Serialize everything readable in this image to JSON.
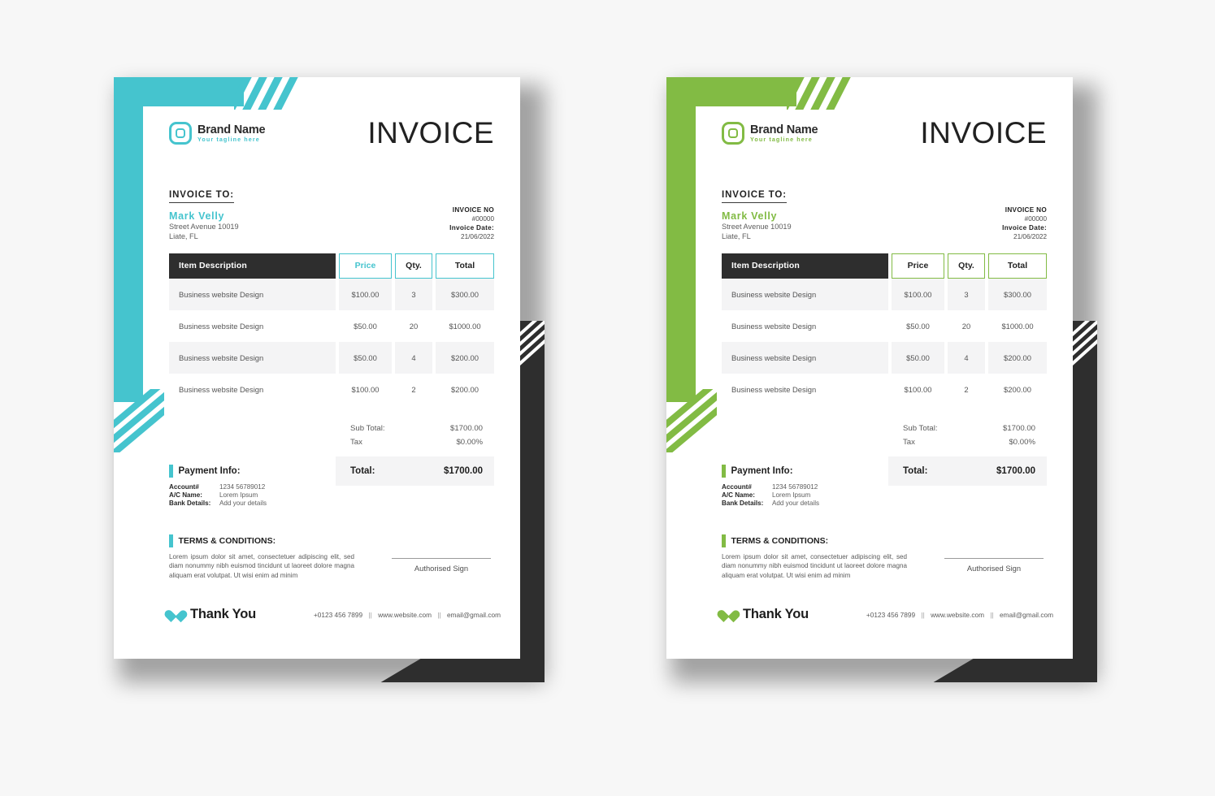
{
  "variants": [
    {
      "id": "teal",
      "accent": "#45C4CE",
      "name": "teal-invoice"
    },
    {
      "id": "green",
      "accent": "#82BB44",
      "name": "green-invoice"
    }
  ],
  "invoice": {
    "title": "INVOICE",
    "brand": {
      "name": "Brand Name",
      "tagline": "Your tagline here",
      "logo_icon": "squircle-diamond-logo-icon"
    },
    "bill_to": {
      "heading": "INVOICE TO:",
      "client_name": "Mark Velly",
      "address_line1": "Street Avenue 10019",
      "address_line2": "Liate, FL"
    },
    "meta": {
      "invoice_no_label": "INVOICE NO",
      "invoice_no_value": "#00000",
      "invoice_date_label": "Invoice Date:",
      "invoice_date_value": "21/06/2022"
    },
    "table": {
      "headers": [
        "Item Description",
        "Price",
        "Qty.",
        "Total"
      ],
      "rows": [
        {
          "description": "Business website Design",
          "price": "$100.00",
          "qty": "3",
          "total": "$300.00"
        },
        {
          "description": "Business website Design",
          "price": "$50.00",
          "qty": "20",
          "total": "$1000.00"
        },
        {
          "description": "Business website Design",
          "price": "$50.00",
          "qty": "4",
          "total": "$200.00"
        },
        {
          "description": "Business website Design",
          "price": "$100.00",
          "qty": "2",
          "total": "$200.00"
        }
      ]
    },
    "totals": {
      "subtotal_label": "Sub Total:",
      "subtotal_value": "$1700.00",
      "tax_label": "Tax",
      "tax_value": "$0.00%",
      "total_label": "Total:",
      "total_value": "$1700.00"
    },
    "payment_info": {
      "heading": "Payment Info:",
      "rows": [
        {
          "label": "Account#",
          "value": "1234 56789012"
        },
        {
          "label": "A/C Name:",
          "value": "Lorem Ipsum"
        },
        {
          "label": "Bank Details:",
          "value": "Add your details"
        }
      ]
    },
    "terms": {
      "heading": "TERMS & CONDITIONS:",
      "body": "Lorem ipsum dolor sit amet, consectetuer adipiscing elit, sed diam nonummy nibh euismod tincidunt ut laoreet dolore magna aliquam erat volutpat. Ut wisi enim ad minim"
    },
    "signature": {
      "label": "Authorised Sign"
    },
    "footer": {
      "thanks_icon": "heart-icon",
      "thanks": "Thank You",
      "phone": "+0123 456 7899",
      "website": "www.website.com",
      "email": "email@gmail.com",
      "separator": "||"
    }
  }
}
